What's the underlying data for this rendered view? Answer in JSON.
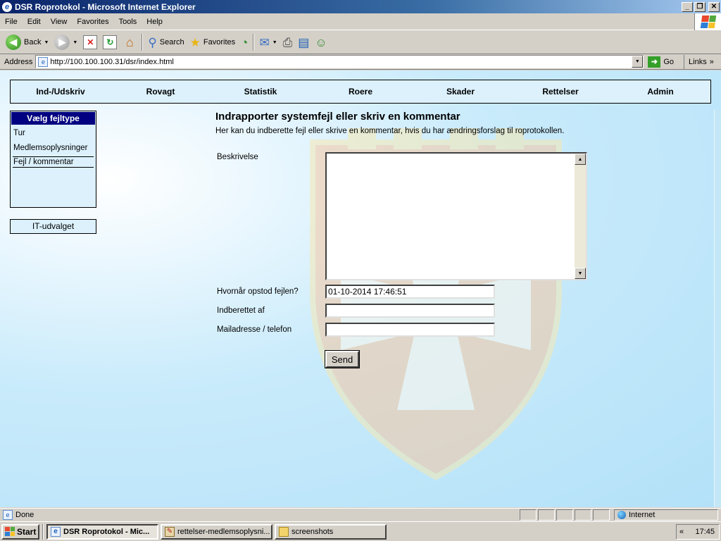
{
  "window": {
    "title": "DSR Roprotokol - Microsoft Internet Explorer",
    "minimize_glyph": "_",
    "maximize_glyph": "❐",
    "close_glyph": "✕"
  },
  "menu": [
    "File",
    "Edit",
    "View",
    "Favorites",
    "Tools",
    "Help"
  ],
  "toolbar": {
    "back_label": "Back",
    "search_label": "Search",
    "favorites_label": "Favorites"
  },
  "address": {
    "label": "Address",
    "url": "http://100.100.100.31/dsr/index.html",
    "go_label": "Go",
    "links_label": "Links"
  },
  "nav": [
    "Ind-/Udskriv",
    "Rovagt",
    "Statistik",
    "Roere",
    "Skader",
    "Rettelser",
    "Admin"
  ],
  "sidebar": {
    "heading": "Vælg fejltype",
    "items": [
      {
        "label": "Tur",
        "active": false
      },
      {
        "label": "Medlemsoplysninger",
        "active": false
      },
      {
        "label": "Fejl / kommentar",
        "active": true
      }
    ],
    "it_label": "IT-udvalget"
  },
  "form": {
    "title": "Indrapporter systemfejl eller skriv en kommentar",
    "subtitle": "Her kan du indberette fejl eller skrive en kommentar, hvis du har ændringsforslag til roprotokollen.",
    "description_label": "Beskrivelse",
    "description_value": "",
    "when_label": "Hvornår opstod fejlen?",
    "when_value": "01-10-2014 17:46:51",
    "reported_by_label": "Indberettet af",
    "reported_by_value": "",
    "contact_label": "Mailadresse / telefon",
    "contact_value": "",
    "send_label": "Send"
  },
  "status": {
    "text": "Done",
    "zone": "Internet"
  },
  "taskbar": {
    "start_label": "Start",
    "tasks": [
      {
        "label": "DSR Roprotokol - Mic...",
        "active": true
      },
      {
        "label": "rettelser-medlemsoplysni...",
        "active": false
      },
      {
        "label": "screenshots",
        "active": false
      }
    ],
    "tray_chevron": "«",
    "clock": "17:45"
  },
  "colors": {
    "title_bar": "#0a246a",
    "sidebar_heading_bg": "#000080",
    "panel_bg": "#dcf1fc",
    "page_bg": "#c9ebfb"
  }
}
